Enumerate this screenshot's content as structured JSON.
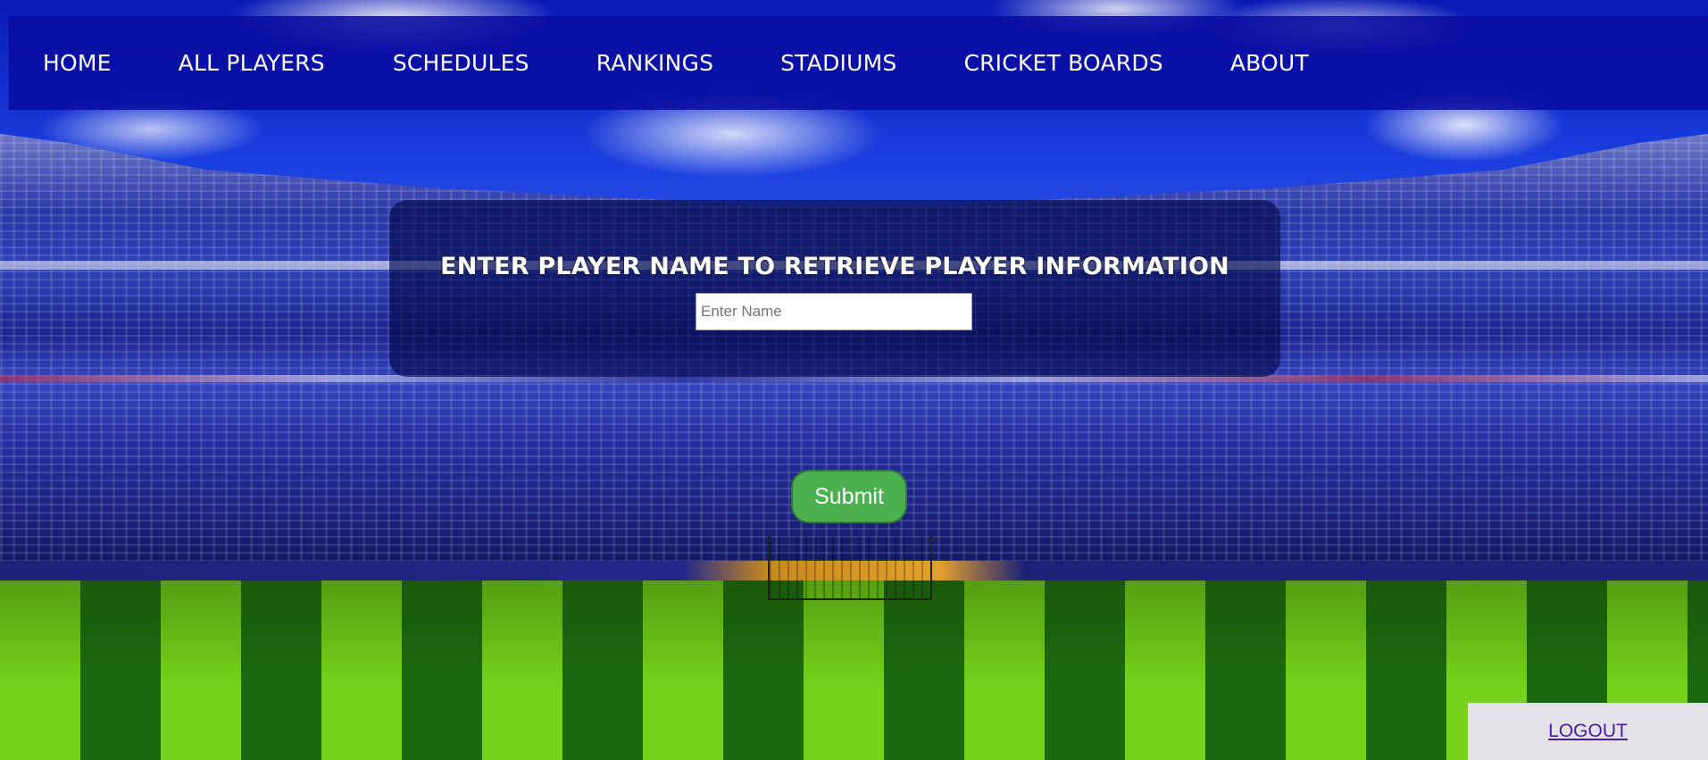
{
  "nav": {
    "items": [
      {
        "label": "HOME"
      },
      {
        "label": "ALL PLAYERS"
      },
      {
        "label": "SCHEDULES"
      },
      {
        "label": "RANKINGS"
      },
      {
        "label": "STADIUMS"
      },
      {
        "label": "CRICKET BOARDS"
      },
      {
        "label": "ABOUT"
      }
    ]
  },
  "search": {
    "heading": "ENTER PLAYER NAME TO RETRIEVE PLAYER INFORMATION",
    "input_value": "",
    "placeholder": "Enter Name",
    "submit_label": "Submit"
  },
  "footer": {
    "logout_label": "LOGOUT"
  },
  "colors": {
    "nav_bg": "#0a0ca0",
    "submit_bg": "#4caf50",
    "logout_link": "#4b1d9a"
  }
}
